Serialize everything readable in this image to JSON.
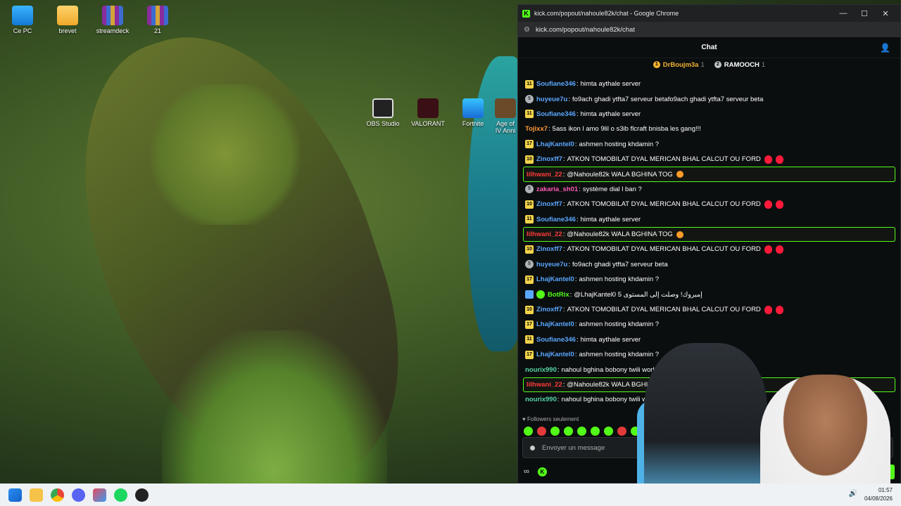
{
  "desktop": {
    "icons": [
      {
        "label": "Ce PC",
        "icon": "monitor-icon"
      },
      {
        "label": "brevet",
        "icon": "folder-icon"
      },
      {
        "label": "streamdeck",
        "icon": "winrar-icon"
      },
      {
        "label": "21",
        "icon": "winrar-icon"
      },
      {
        "label": "OBS Studio",
        "icon": "obs-icon"
      },
      {
        "label": "VALORANT",
        "icon": "valorant-icon"
      },
      {
        "label": "Fortnite",
        "icon": "fortnite-icon"
      },
      {
        "label": "Age of IV Anni",
        "icon": "age-icon"
      }
    ]
  },
  "window": {
    "title": "kick.com/popout/nahoule82k/chat - Google Chrome",
    "url": "kick.com/popout/nahoule82k/chat",
    "controls": {
      "minimize": "—",
      "maximize": "☐",
      "close": "✕"
    }
  },
  "chat": {
    "header": "Chat",
    "leaders": [
      {
        "name": "DrBoujm3a",
        "count": "1",
        "rank": "1"
      },
      {
        "name": "RAMOOCH",
        "count": "1",
        "rank": "2"
      }
    ],
    "messages": [
      {
        "badge": "11",
        "badge_type": "gold",
        "user": "Soufiane346",
        "color": "#5aa7ff",
        "text": "himta aythale server",
        "emotes": 0,
        "hl": false
      },
      {
        "badge": "5",
        "badge_type": "gray",
        "user": "huyeue7u",
        "color": "#5aa7ff",
        "text": "fo9ach ghadi ytfta7 serveur betafo9ach ghadi ytfta7 serveur beta",
        "emotes": 0,
        "hl": false
      },
      {
        "badge": "11",
        "badge_type": "gold",
        "user": "Soufiane346",
        "color": "#5aa7ff",
        "text": "himta aythale server",
        "emotes": 0,
        "hl": false
      },
      {
        "badge": "",
        "badge_type": "none",
        "user": "Tojixx7",
        "color": "#ff9a3c",
        "text": "5ass ikon l amo 9lil o s3ib flcraft bnisba les gang!!!",
        "emotes": 0,
        "hl": false
      },
      {
        "badge": "17",
        "badge_type": "gold",
        "user": "LhajKantel0",
        "color": "#5aa7ff",
        "text": "ashmen hosting khdamin ?",
        "emotes": 0,
        "hl": false
      },
      {
        "badge": "10",
        "badge_type": "gold",
        "user": "Zinoxff7",
        "color": "#5aa7ff",
        "text": "ATKON TOMOBILAT DYAL MERICAN BHAL CALCUT OU FORD",
        "emotes": 2,
        "hl": false
      },
      {
        "badge": "",
        "badge_type": "none",
        "user": "lilhwani_22",
        "color": "#ff3b3b",
        "text": "@Nahoule82k WALA BGHINA TOG",
        "emotes": 0,
        "smile": true,
        "hl": true
      },
      {
        "badge": "5",
        "badge_type": "gray",
        "user": "zakaria_sh01",
        "color": "#ff5ab4",
        "text": "système dial l ban ?",
        "emotes": 0,
        "hl": false
      },
      {
        "badge": "10",
        "badge_type": "gold",
        "user": "Zinoxff7",
        "color": "#5aa7ff",
        "text": "ATKON TOMOBILAT DYAL MERICAN BHAL CALCUT OU FORD",
        "emotes": 2,
        "hl": false
      },
      {
        "badge": "11",
        "badge_type": "gold",
        "user": "Soufiane346",
        "color": "#5aa7ff",
        "text": "himta aythale server",
        "emotes": 0,
        "hl": false
      },
      {
        "badge": "",
        "badge_type": "none",
        "user": "lilhwani_22",
        "color": "#ff3b3b",
        "text": "@Nahoule82k WALA BGHINA TOG",
        "emotes": 0,
        "smile": true,
        "hl": true
      },
      {
        "badge": "10",
        "badge_type": "gold",
        "user": "Zinoxff7",
        "color": "#5aa7ff",
        "text": "ATKON TOMOBILAT DYAL MERICAN BHAL CALCUT OU FORD",
        "emotes": 2,
        "hl": false
      },
      {
        "badge": "5",
        "badge_type": "gray",
        "user": "huyeue7u",
        "color": "#5aa7ff",
        "text": "fo9ach ghadi ytfta7 serveur beta",
        "emotes": 0,
        "hl": false
      },
      {
        "badge": "17",
        "badge_type": "gold",
        "user": "LhajKantel0",
        "color": "#5aa7ff",
        "text": "ashmen hosting khdamin ?",
        "emotes": 0,
        "hl": false
      },
      {
        "badge": "",
        "badge_type": "bot",
        "user": "BotRix",
        "color": "#53fc18",
        "text": "@LhajKantel0 5 إمبروك! وصلت إلى المستوى",
        "emotes": 0,
        "hl": false
      },
      {
        "badge": "10",
        "badge_type": "gold",
        "user": "Zinoxff7",
        "color": "#5aa7ff",
        "text": "ATKON TOMOBILAT DYAL MERICAN BHAL CALCUT OU FORD",
        "emotes": 2,
        "hl": false
      },
      {
        "badge": "17",
        "badge_type": "gold",
        "user": "LhajKantel0",
        "color": "#5aa7ff",
        "text": "ashmen hosting khdamin ?",
        "emotes": 0,
        "hl": false
      },
      {
        "badge": "11",
        "badge_type": "gold",
        "user": "Soufiane346",
        "color": "#5aa7ff",
        "text": "himta aythale server",
        "emotes": 0,
        "hl": false
      },
      {
        "badge": "17",
        "badge_type": "gold",
        "user": "LhajKantel0",
        "color": "#5aa7ff",
        "text": "ashmen hosting khdamin ?",
        "emotes": 0,
        "hl": false
      },
      {
        "badge": "",
        "badge_type": "none",
        "user": "nourix990",
        "color": "#53d6a6",
        "text": "nahoul bghina bobony twili worldwide",
        "emotes": 0,
        "hl": false
      },
      {
        "badge": "",
        "badge_type": "none",
        "user": "lilhwani_22",
        "color": "#ff3b3b",
        "text": "@Nahoule82k WALA BGHINA TOG",
        "emotes": 0,
        "smile": true,
        "hl": true
      },
      {
        "badge": "",
        "badge_type": "none",
        "user": "nourix990",
        "color": "#53d6a6",
        "text": "nahoul bghina bobony twili worldwide",
        "emotes": 0,
        "hl": false
      }
    ],
    "followers_only": "Followers seulement",
    "input_placeholder": "Envoyer un message",
    "send_button": "Chat"
  },
  "taskbar": {
    "time": "01:57",
    "date": "04/08/2026"
  }
}
